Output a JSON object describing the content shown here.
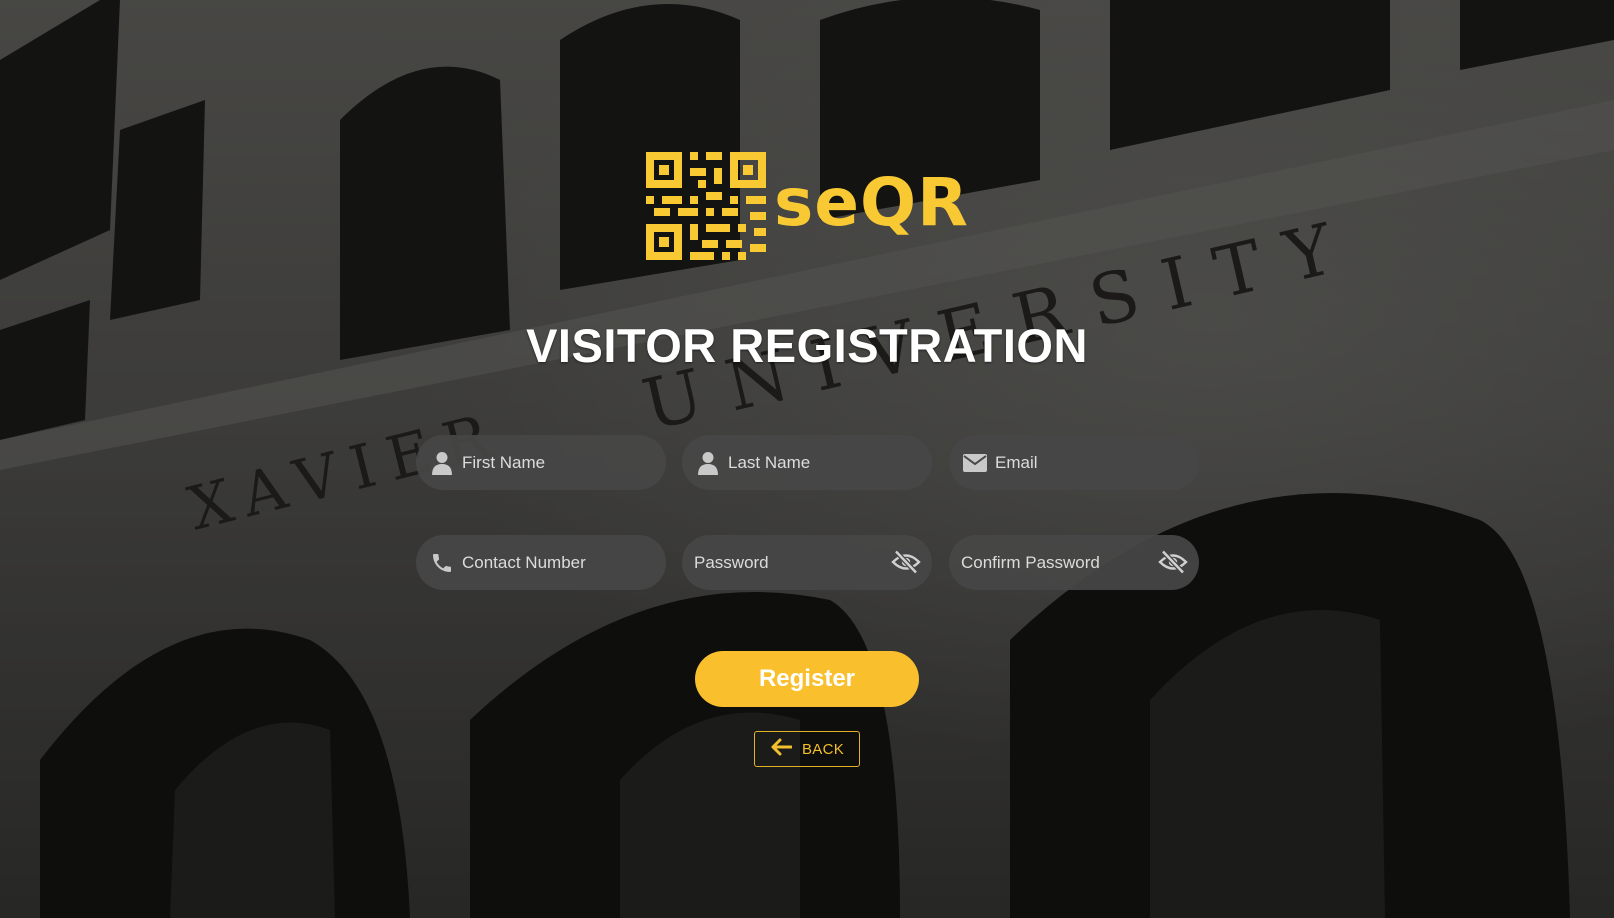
{
  "brand": {
    "name": "seQR",
    "logo_icon": "qr-code-icon",
    "color": "#f9c934"
  },
  "heading": "VISITOR REGISTRATION",
  "background": {
    "engraved_text_left": "XAVIER",
    "engraved_text_center": "UNIVERSITY"
  },
  "form": {
    "first_name": {
      "placeholder": "First Name",
      "value": "",
      "icon": "user-icon"
    },
    "last_name": {
      "placeholder": "Last Name",
      "value": "",
      "icon": "user-icon"
    },
    "email": {
      "placeholder": "Email",
      "value": "",
      "icon": "envelope-icon"
    },
    "contact": {
      "placeholder": "Contact Number",
      "value": "",
      "icon": "phone-icon"
    },
    "password": {
      "placeholder": "Password",
      "value": "",
      "icon": "eye-slash-icon"
    },
    "confirm_password": {
      "placeholder": "Confirm Password",
      "value": "",
      "icon": "eye-slash-icon"
    }
  },
  "buttons": {
    "register_label": "Register",
    "back_label": "BACK",
    "back_icon": "arrow-left-icon"
  },
  "colors": {
    "accent": "#f9bf2c",
    "field_bg": "#464646",
    "text": "#ffffff"
  }
}
